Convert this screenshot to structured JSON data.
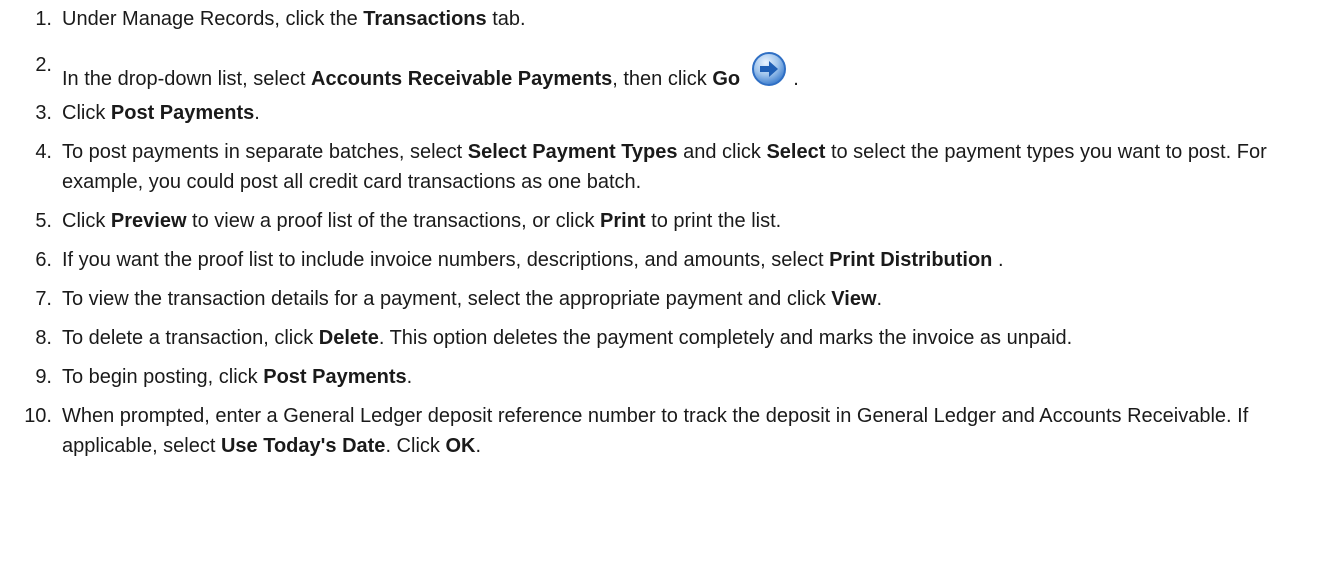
{
  "steps": [
    {
      "num": "1.",
      "parts": [
        {
          "t": "Under Manage Records, click the "
        },
        {
          "b": "Transactions"
        },
        {
          "t": " tab."
        }
      ]
    },
    {
      "num": "2.",
      "parts": [
        {
          "t": "In the drop-down list, select "
        },
        {
          "b": "Accounts Receivable Payments"
        },
        {
          "t": ", then click "
        },
        {
          "b": "Go"
        }
      ],
      "trailing_icon": "go-arrow-icon",
      "after_icon": " ."
    },
    {
      "num": "3.",
      "parts": [
        {
          "t": "Click "
        },
        {
          "b": "Post Payments"
        },
        {
          "t": "."
        }
      ]
    },
    {
      "num": "4.",
      "parts": [
        {
          "t": "To post payments in separate batches, select "
        },
        {
          "b": "Select Payment Types"
        },
        {
          "t": " and click "
        },
        {
          "b": "Select"
        },
        {
          "t": " to select the payment types you want to post. For example, you could post all credit card transactions as one batch."
        }
      ]
    },
    {
      "num": "5.",
      "parts": [
        {
          "t": "Click "
        },
        {
          "b": "Preview"
        },
        {
          "t": " to view a proof list of the transactions, or click "
        },
        {
          "b": "Print"
        },
        {
          "t": " to print the list."
        }
      ]
    },
    {
      "num": "6.",
      "parts": [
        {
          "t": "If you want the proof list to include invoice numbers, descriptions, and amounts, select "
        },
        {
          "b": "Print Distribution"
        },
        {
          "t": " ."
        }
      ]
    },
    {
      "num": "7.",
      "parts": [
        {
          "t": "To view the transaction details for a payment, select the appropriate payment and click "
        },
        {
          "b": "View"
        },
        {
          "t": "."
        }
      ]
    },
    {
      "num": "8.",
      "parts": [
        {
          "t": "To delete a transaction, click "
        },
        {
          "b": "Delete"
        },
        {
          "t": ". This option deletes the payment completely and marks the invoice as unpaid."
        }
      ]
    },
    {
      "num": "9.",
      "parts": [
        {
          "t": "To begin posting, click "
        },
        {
          "b": "Post Payments"
        },
        {
          "t": "."
        }
      ]
    },
    {
      "num": "10.",
      "parts": [
        {
          "t": "When prompted, enter a General Ledger deposit reference number to track the deposit in General Ledger and Accounts Receivable. If applicable, select "
        },
        {
          "b": "Use Today's Date"
        },
        {
          "t": ". Click "
        },
        {
          "b": "OK"
        },
        {
          "t": "."
        }
      ]
    }
  ],
  "colors": {
    "text": "#1a1a1a",
    "icon_blue": "#2f6fc4",
    "icon_light": "#bcd6f2"
  }
}
